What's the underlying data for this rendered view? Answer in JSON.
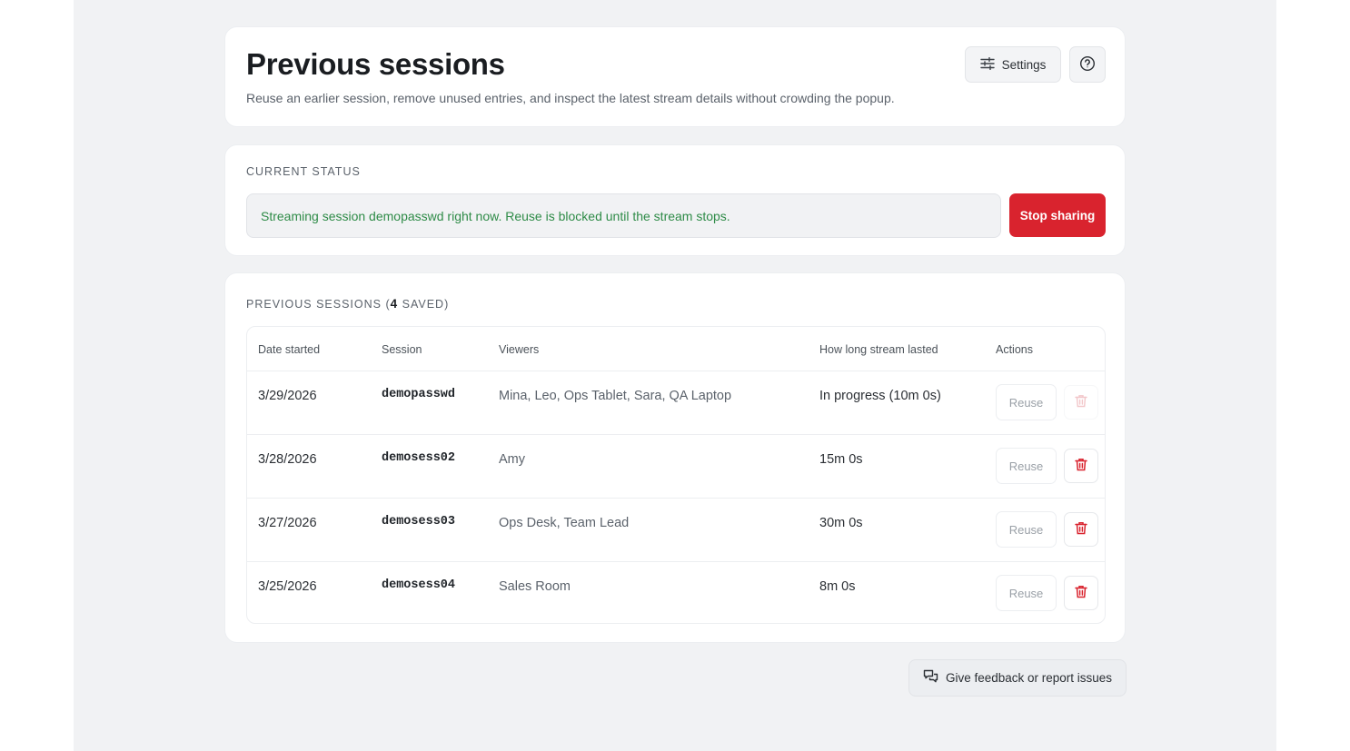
{
  "header": {
    "title": "Previous sessions",
    "subtitle": "Reuse an earlier session, remove unused entries, and inspect the latest stream details without crowding the popup.",
    "settings_label": "Settings",
    "settings_icon": "sliders-icon",
    "help_icon": "question-circle-icon"
  },
  "status": {
    "section_title": "CURRENT STATUS",
    "message": "Streaming session demopasswd right now. Reuse is blocked until the stream stops.",
    "stop_label": "Stop sharing",
    "message_color": "#2e8b47",
    "stop_color": "#d9232e"
  },
  "sessions": {
    "title_prefix": "PREVIOUS SESSIONS (",
    "count": "4",
    "title_suffix": " SAVED)",
    "columns": [
      "Date started",
      "Session",
      "Viewers",
      "How long stream lasted",
      "Actions"
    ],
    "reuse_label": "Reuse",
    "delete_icon": "trash-icon",
    "rows": [
      {
        "date": "3/29/2026",
        "session": "demopasswd",
        "viewers": "Mina, Leo, Ops Tablet, Sara, QA Laptop",
        "duration": "In progress (10m 0s)",
        "delete_enabled": false
      },
      {
        "date": "3/28/2026",
        "session": "demosess02",
        "viewers": "Amy",
        "duration": "15m 0s",
        "delete_enabled": true
      },
      {
        "date": "3/27/2026",
        "session": "demosess03",
        "viewers": "Ops Desk, Team Lead",
        "duration": "30m 0s",
        "delete_enabled": true
      },
      {
        "date": "3/25/2026",
        "session": "demosess04",
        "viewers": "Sales Room",
        "duration": "8m 0s",
        "delete_enabled": true
      }
    ]
  },
  "footer": {
    "feedback_label": "Give feedback or report issues",
    "feedback_icon": "chat-bubbles-icon"
  }
}
